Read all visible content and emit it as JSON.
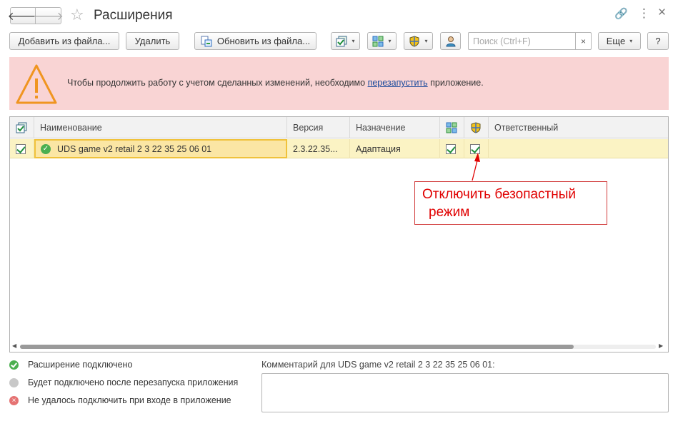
{
  "window": {
    "title": "Расширения",
    "back_glyph": "🡐",
    "forward_glyph": "🡒",
    "star_glyph": "☆",
    "link_glyph": "🔗",
    "menu_glyph": "⋮",
    "close_glyph": "×"
  },
  "toolbar": {
    "add_from_file": "Добавить из файла...",
    "delete": "Удалить",
    "update_from_file": "Обновить из файла...",
    "caret": "▾",
    "search_placeholder": "Поиск (Ctrl+F)",
    "search_clear": "×",
    "more": "Еще",
    "help": "?"
  },
  "warning": {
    "text_before": "Чтобы продолжить работу с учетом сделанных изменений, необходимо ",
    "link": "перезапустить",
    "text_after": " приложение."
  },
  "table": {
    "columns": {
      "name": "Наименование",
      "version": "Версия",
      "purpose": "Назначение",
      "responsible": "Ответственный"
    },
    "rows": [
      {
        "name": "UDS game v2 retail 2 3 22 35 25 06 01",
        "version": "2.3.22.35...",
        "purpose": "Адаптация",
        "active": true,
        "isolation": true,
        "safe_mode": true,
        "responsible": ""
      }
    ]
  },
  "annotation": {
    "line1": "Отключить безопастный",
    "line2": "режим",
    "color": "#e00000"
  },
  "legend": {
    "connected": "Расширение подключено",
    "pending": "Будет подключено после перезапуска приложения",
    "failed": "Не удалось подключить при входе в приложение"
  },
  "comment": {
    "label": "Комментарий для UDS game v2 retail 2 3 22 35 25 06 01:",
    "value": ""
  },
  "colors": {
    "warning_bg": "#f9d4d4",
    "selected_row": "#fbf3c4",
    "accent_yellow": "#f0c23b",
    "status_ok": "#4caf50",
    "status_fail": "#e57373"
  },
  "icons": [
    "back-arrow-icon",
    "forward-arrow-icon",
    "favorite-star-icon",
    "link-icon",
    "more-menu-icon",
    "close-icon",
    "stack-checkbox-icon",
    "isolation-icon",
    "shield-icon",
    "user-icon",
    "warning-triangle-icon",
    "check-circle-icon"
  ]
}
